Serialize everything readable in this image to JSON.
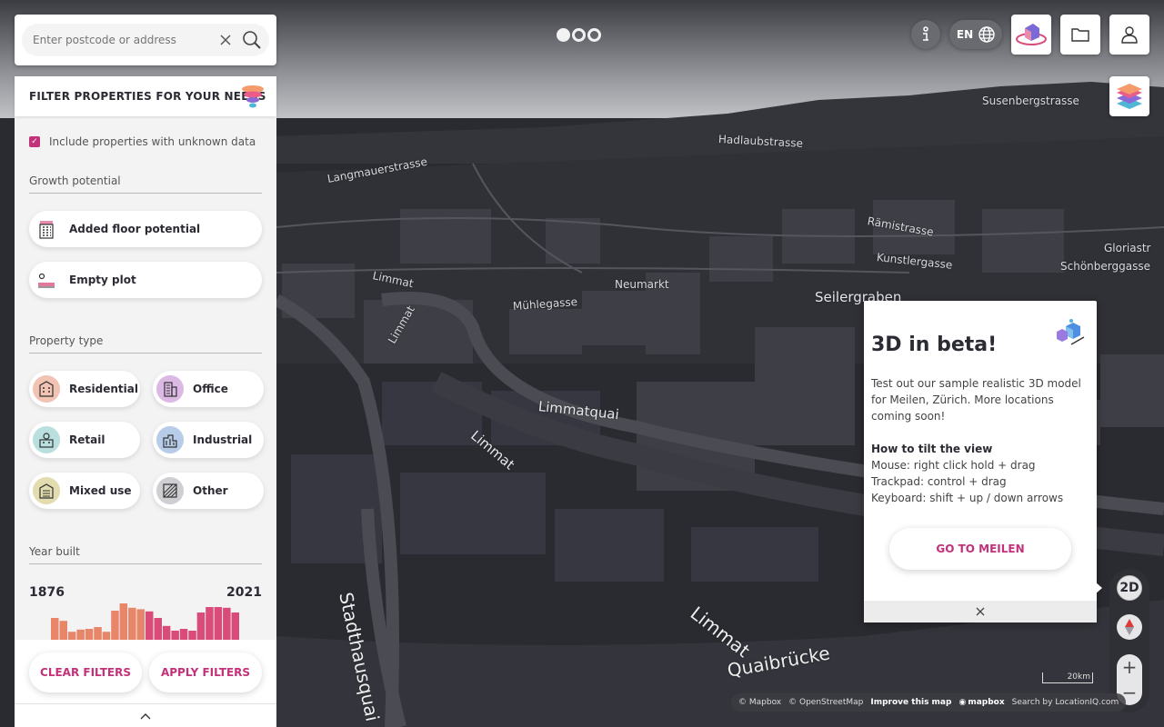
{
  "search": {
    "placeholder": "Enter postcode or address"
  },
  "header": {
    "language": "EN"
  },
  "filters": {
    "title": "FILTER PROPERTIES FOR YOUR NEEDS",
    "include_unknown_label": "Include properties with unknown data",
    "include_unknown_checked": true,
    "growth_title": "Growth potential",
    "growth_options": [
      "Added floor potential",
      "Empty plot"
    ],
    "property_type_title": "Property type",
    "property_types": [
      "Residential",
      "Office",
      "Retail",
      "Industrial",
      "Mixed use",
      "Other"
    ],
    "year_title": "Year built",
    "year_min": "1876",
    "year_max": "2021",
    "clear_label": "CLEAR FILTERS",
    "apply_label": "APPLY FILTERS"
  },
  "beta_popup": {
    "title": "3D in beta!",
    "description": "Test out our sample realistic 3D model for Meilen, Zürich. More locations coming soon!",
    "howto_title": "How to tilt the view",
    "howto_lines": [
      "Mouse: right click hold + drag",
      "Trackpad: control + drag",
      "Keyboard: shift + up / down arrows"
    ],
    "button_label": "GO TO MEILEN"
  },
  "map_controls": {
    "mode_label": "2D",
    "zoom_in": "+",
    "zoom_out": "−"
  },
  "scale_label": "20km",
  "attribution": {
    "mapbox": "© Mapbox",
    "osm": "© OpenStreetMap",
    "improve": "Improve this map",
    "logo": "mapbox",
    "search": "Search by LocationIQ.com"
  },
  "map_labels": [
    "Susenbergstrasse",
    "Hadlaubstrasse",
    "Gloriastr",
    "Kunstlergasse",
    "Seilergraben",
    "Limmat",
    "Limmat",
    "Limmat",
    "Limmatquai",
    "Limmat",
    "Stadthausquai",
    "Quaibrücke",
    "Mühlegasse",
    "Langmauerstrasse",
    "Neumarkt",
    "Rämistrasse",
    "Schönberggasse"
  ],
  "colors": {
    "accent": "#c2317a",
    "panel_bg": "#f3f3f4",
    "map_bg": "#2a2b30"
  },
  "histogram": {
    "colors": [
      "#e8866a",
      "#d94c79"
    ],
    "values": [
      0.6,
      0.52,
      0.22,
      0.28,
      0.3,
      0.35,
      0.22,
      0.8,
      1.0,
      0.88,
      0.84,
      0.78,
      0.6,
      0.38,
      0.25,
      0.3,
      0.25,
      0.75,
      0.9,
      0.9,
      0.88,
      0.75
    ]
  }
}
